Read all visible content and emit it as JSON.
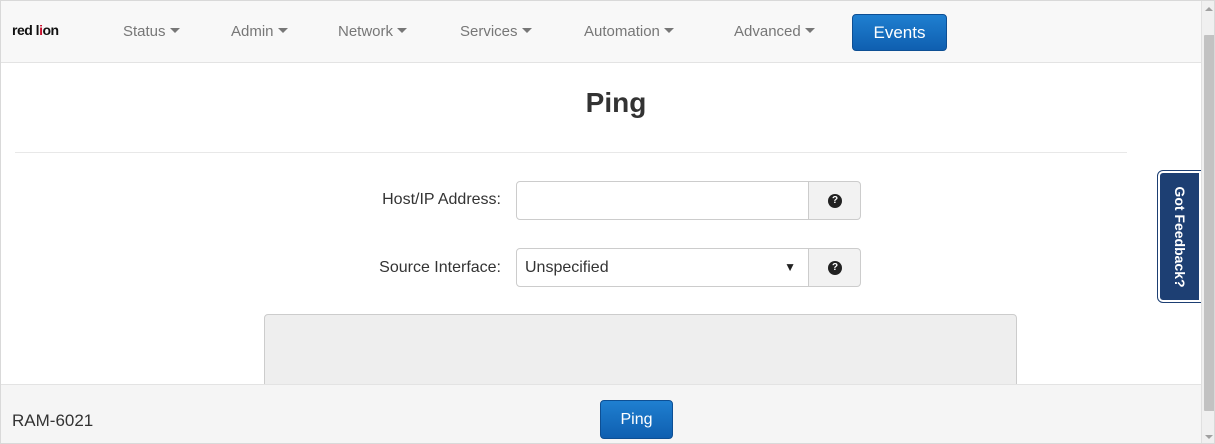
{
  "navbar": {
    "logo_prefix": "red l",
    "logo_mark": "i",
    "logo_suffix": "on",
    "items": [
      {
        "label": "Status"
      },
      {
        "label": "Admin"
      },
      {
        "label": "Network"
      },
      {
        "label": "Services"
      },
      {
        "label": "Automation"
      },
      {
        "label": "Advanced"
      }
    ],
    "events_label": "Events"
  },
  "main": {
    "title": "Ping",
    "form": {
      "host_label": "Host/IP Address:",
      "host_value": "",
      "host_placeholder": "",
      "source_label": "Source Interface:",
      "source_value": "Unspecified",
      "help_icon_glyph": "?"
    },
    "output": ""
  },
  "footer": {
    "device_name": "RAM-6021",
    "ping_label": "Ping"
  },
  "feedback": {
    "label": "Got Feedback?"
  },
  "colors": {
    "accent": "#1565c0",
    "feedback_bg": "#1d3f73",
    "navbar_bg": "#f8f8f8",
    "output_bg": "#eeeeee"
  },
  "icons": {
    "nav_caret": "caret-down-icon",
    "help": "question-circle-icon",
    "select_arrow": "triangle-down-icon"
  }
}
